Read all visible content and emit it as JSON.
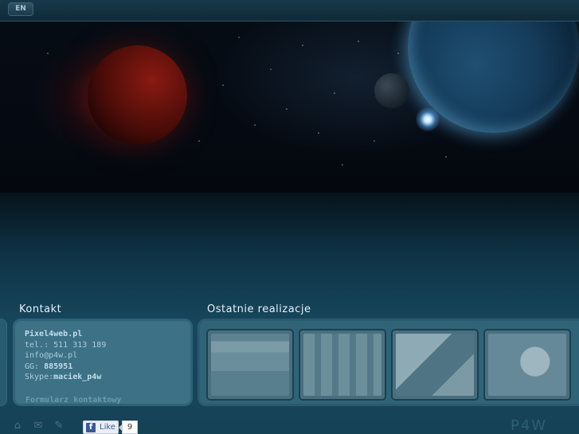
{
  "topbar": {
    "lang_label": "EN"
  },
  "sections": {
    "contact_title": "Kontakt",
    "work_title": "Ostatnie realizacje"
  },
  "contact": {
    "company": "Pixel4web.pl",
    "phone": "tel.: 511 313 189",
    "email": "info@p4w.pl",
    "gg_label": "GG: ",
    "gg_value": "885951",
    "skype_label": "Skype:",
    "skype_value": "maciek_p4w",
    "form_link": "Formularz kontaktowy"
  },
  "portfolio": {
    "items": [
      {},
      {},
      {},
      {}
    ]
  },
  "footer": {
    "icons": [
      "home-icon",
      "mail-icon",
      "edit-icon"
    ],
    "fb_like_label": "Like",
    "fb_like_count": "9",
    "brand": "P4W"
  }
}
